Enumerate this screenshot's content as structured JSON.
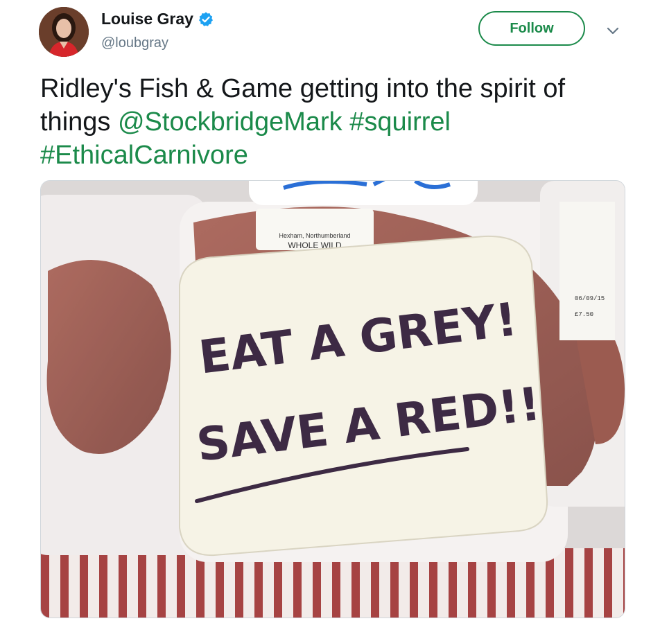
{
  "author": {
    "name": "Louise Gray",
    "handle": "@loubgray",
    "verified": true,
    "avatar_icon": "avatar-photo"
  },
  "actions": {
    "follow_label": "Follow",
    "more_icon": "chevron-down-icon"
  },
  "tweet": {
    "text_plain": "Ridley's Fish & Game getting into the spirit of things ",
    "mention": "@StockbridgeMark",
    "hashtag1": "#squirrel",
    "hashtag2": "#EthicalCarnivore"
  },
  "photo": {
    "sign_line1": "EAT A GREY!",
    "sign_line2": "SAVE A RED!!",
    "label_location": "Hexham, Northumberland",
    "label_product": "WHOLE WILD",
    "side_label_date": "06/09/15",
    "side_label_price": "£7.50"
  },
  "colors": {
    "accent": "#1b8a4a",
    "verified": "#1da1f2",
    "text": "#14171a",
    "secondary": "#657786"
  }
}
